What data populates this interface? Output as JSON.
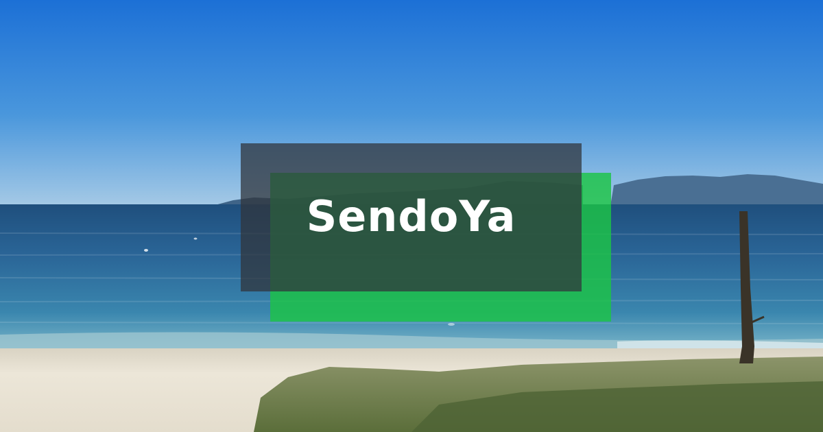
{
  "title": "SendoYa",
  "colors": {
    "sky_top": "#1f74d8",
    "sky_horizon": "#a9cde8",
    "sea_far": "#2a5f8c",
    "sea_near": "#3f86ad",
    "sand": "#e9e3d6",
    "grass": "#6f7f4a",
    "accent_green": "#1cc446",
    "overlay_dark": "#30343c"
  },
  "scene_elements": [
    "sky",
    "mountains",
    "sea",
    "beach",
    "grass",
    "wooden-post"
  ]
}
